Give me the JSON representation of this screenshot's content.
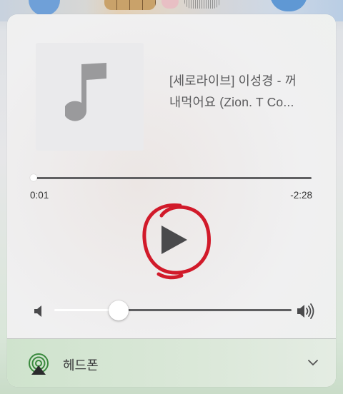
{
  "now_playing": {
    "title_line1": "[세로라이브] 이성경 - 꺼",
    "title_line2": "내먹어요 (Zion. T Co...",
    "artwork_icon": "music-note-icon"
  },
  "progress": {
    "elapsed": "0:01",
    "remaining": "-2:28",
    "fraction": 0.01
  },
  "controls": {
    "play_icon": "play-icon",
    "annotation": "red-circle-scribble"
  },
  "volume": {
    "level": 0.33,
    "low_icon": "speaker-low-icon",
    "high_icon": "speaker-high-icon"
  },
  "route": {
    "label": "헤드폰",
    "icon": "airplay-icon",
    "expand_icon": "chevron-down-icon"
  },
  "colors": {
    "track": "#5f5f61",
    "route_accent": "#3a8a3e",
    "annotation": "#d11a2a"
  }
}
